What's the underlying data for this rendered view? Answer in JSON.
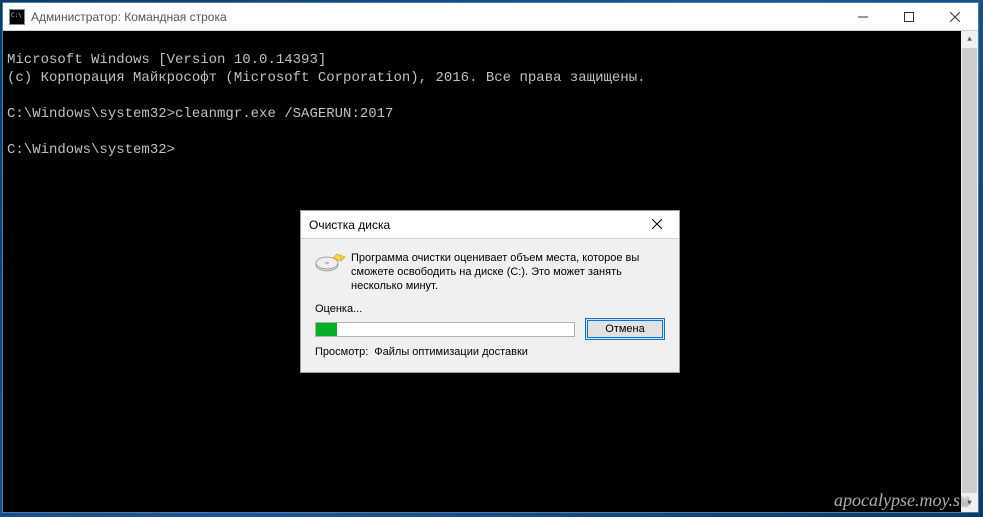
{
  "window": {
    "title": "Администратор: Командная строка"
  },
  "terminal": {
    "line1": "Microsoft Windows [Version 10.0.14393]",
    "line2": "(c) Корпорация Майкрософт (Microsoft Corporation), 2016. Все права защищены.",
    "line3": "",
    "line4": "C:\\Windows\\system32>cleanmgr.exe /SAGERUN:2017",
    "line5": "",
    "line6": "C:\\Windows\\system32>"
  },
  "dialog": {
    "title": "Очистка диска",
    "message": "Программа очистки оценивает объем места, которое вы сможете освободить на диске  (C:). Это может занять несколько минут.",
    "estimate_label": "Оценка...",
    "cancel_label": "Отмена",
    "scan_label": "Просмотр:",
    "scan_value": "Файлы оптимизации доставки",
    "progress_percent": 8
  },
  "watermark": "apocalypse.moy.su"
}
